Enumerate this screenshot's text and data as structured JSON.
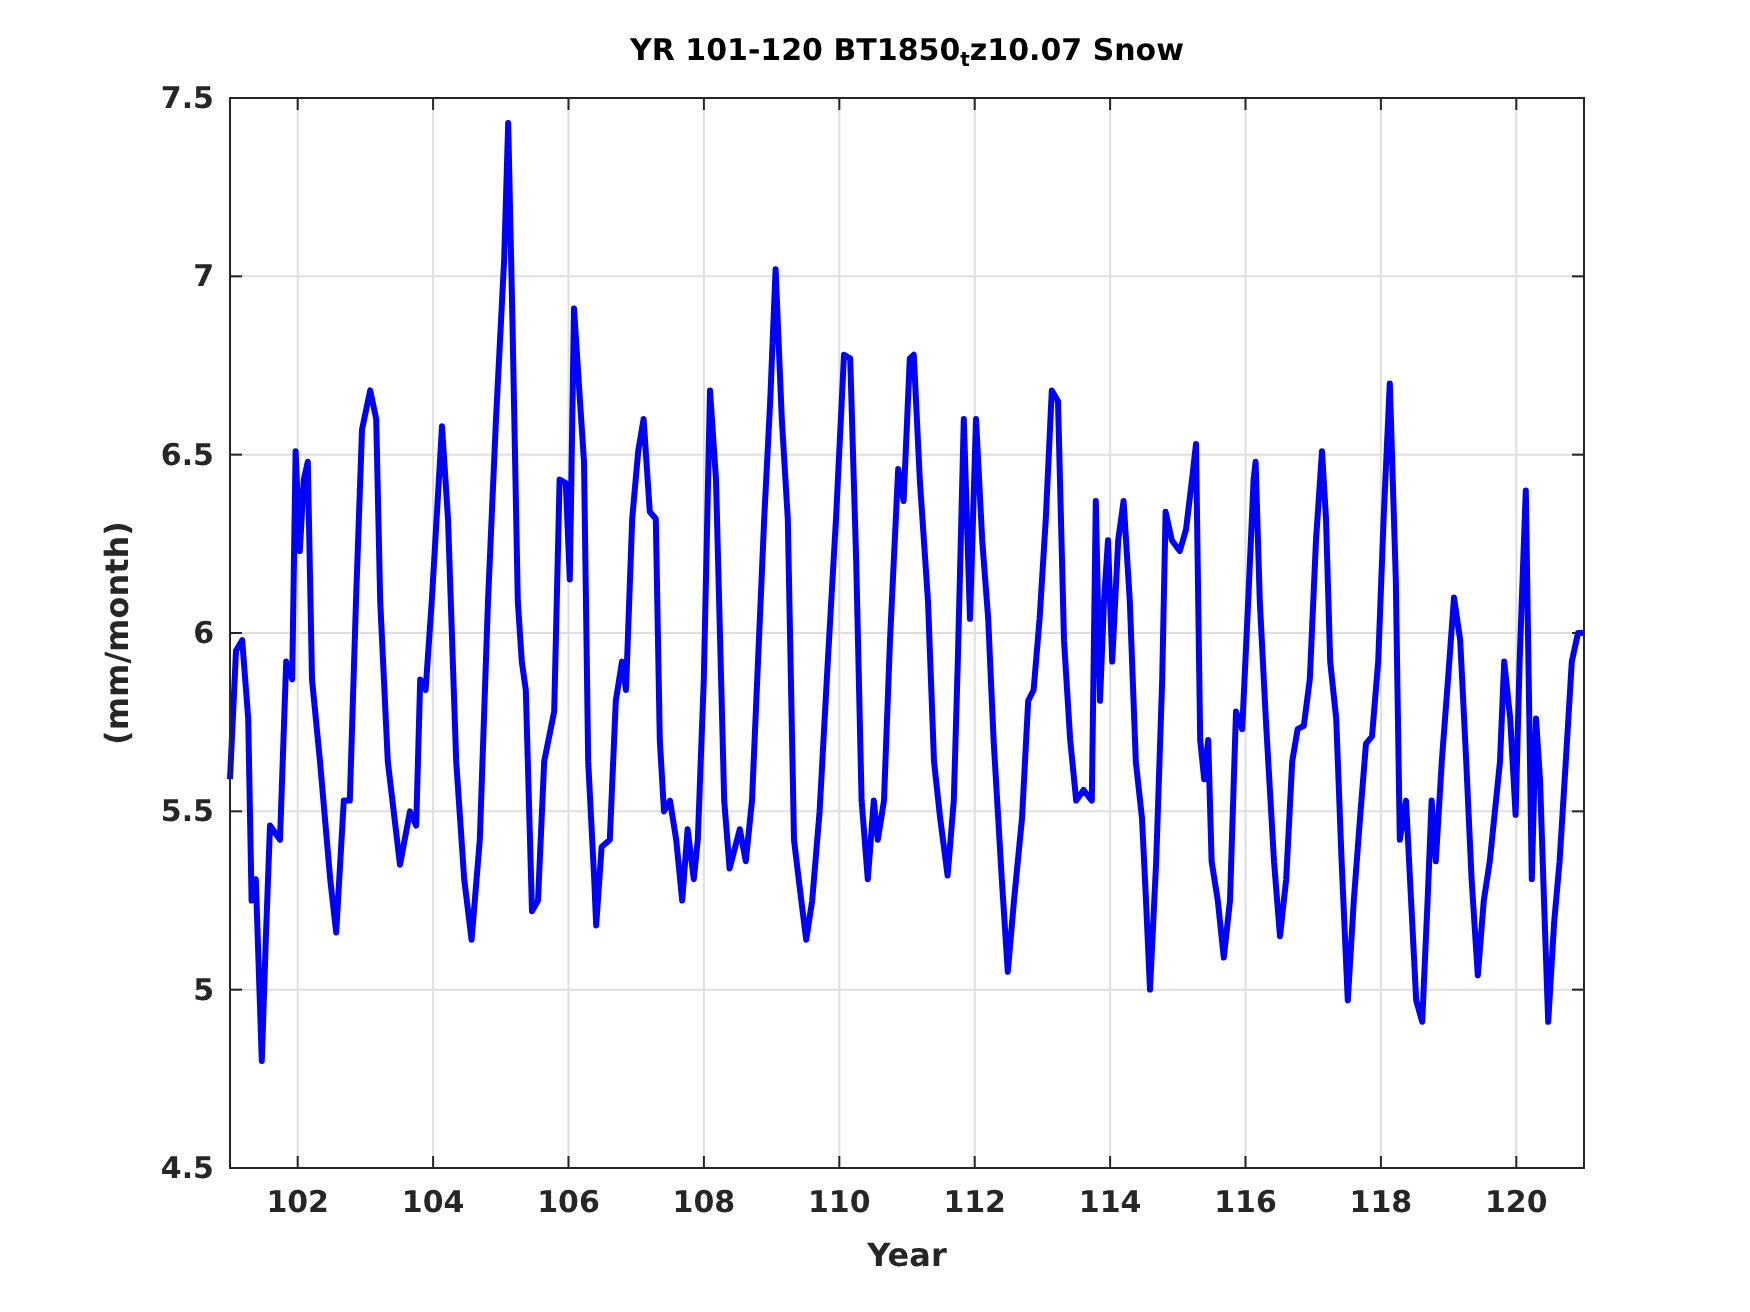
{
  "figure": {
    "chart_data": {
      "type": "line",
      "grid": true,
      "title": "YR 101-120 BT1850$_{t}$z10.07 Snow",
      "xlabel": "Year",
      "ylabel": "(mm/month)",
      "xlim": [
        101,
        121
      ],
      "ylim": [
        4.5,
        7.5
      ],
      "xticks": [
        102,
        104,
        106,
        108,
        110,
        112,
        114,
        116,
        118,
        120
      ],
      "yticks": [
        4.5,
        {
          "value": 5,
          "label": "5"
        },
        5.5,
        {
          "value": 6,
          "label": "6"
        },
        6.5,
        {
          "value": 7,
          "label": "7"
        },
        7.5
      ],
      "x": [
        101.0,
        101.09,
        101.18,
        101.27,
        101.32,
        101.38,
        101.44,
        101.47,
        101.53,
        101.59,
        101.74,
        101.83,
        101.92,
        101.97,
        102.03,
        102.09,
        102.15,
        102.21,
        102.33,
        102.48,
        102.57,
        102.68,
        102.77,
        102.86,
        102.95,
        103.07,
        103.16,
        103.22,
        103.33,
        103.51,
        103.66,
        103.75,
        103.81,
        103.89,
        103.98,
        104.13,
        104.22,
        104.34,
        104.46,
        104.57,
        104.69,
        104.81,
        104.93,
        105.05,
        105.11,
        105.17,
        105.25,
        105.31,
        105.37,
        105.46,
        105.55,
        105.64,
        105.79,
        105.87,
        105.96,
        106.02,
        106.08,
        106.17,
        106.23,
        106.29,
        106.38,
        106.41,
        106.49,
        106.61,
        106.7,
        106.79,
        106.85,
        106.94,
        107.03,
        107.11,
        107.2,
        107.29,
        107.35,
        107.41,
        107.5,
        107.59,
        107.68,
        107.76,
        107.85,
        107.91,
        108.0,
        108.09,
        108.18,
        108.3,
        108.38,
        108.53,
        108.62,
        108.71,
        108.8,
        108.89,
        108.98,
        109.06,
        109.15,
        109.24,
        109.33,
        109.42,
        109.51,
        109.6,
        109.71,
        109.83,
        109.95,
        110.07,
        110.16,
        110.25,
        110.33,
        110.42,
        110.51,
        110.57,
        110.66,
        110.75,
        110.87,
        110.95,
        111.04,
        111.1,
        111.19,
        111.31,
        111.4,
        111.49,
        111.6,
        111.69,
        111.75,
        111.84,
        111.93,
        112.02,
        112.11,
        112.2,
        112.28,
        112.4,
        112.49,
        112.58,
        112.7,
        112.79,
        112.87,
        112.96,
        113.05,
        113.14,
        113.23,
        113.32,
        113.41,
        113.5,
        113.61,
        113.73,
        113.79,
        113.85,
        113.91,
        113.97,
        114.03,
        114.12,
        114.2,
        114.29,
        114.38,
        114.47,
        114.53,
        114.59,
        114.68,
        114.77,
        114.82,
        114.91,
        115.03,
        115.12,
        115.21,
        115.27,
        115.33,
        115.39,
        115.45,
        115.5,
        115.59,
        115.68,
        115.77,
        115.86,
        115.95,
        116.04,
        116.12,
        116.15,
        116.21,
        116.3,
        116.42,
        116.51,
        116.6,
        116.69,
        116.77,
        116.86,
        116.95,
        117.04,
        117.13,
        117.19,
        117.25,
        117.34,
        117.42,
        117.51,
        117.6,
        117.69,
        117.78,
        117.87,
        117.96,
        118.04,
        118.13,
        118.22,
        118.28,
        118.37,
        118.43,
        118.52,
        118.61,
        118.69,
        118.75,
        118.81,
        118.9,
        118.99,
        119.08,
        119.17,
        119.26,
        119.34,
        119.43,
        119.52,
        119.61,
        119.7,
        119.76,
        119.82,
        119.91,
        119.99,
        120.05,
        120.14,
        120.23,
        120.29,
        120.35,
        120.41,
        120.47,
        120.56,
        120.64,
        120.73,
        120.82,
        120.91,
        121.0
      ],
      "series": [
        {
          "color": "#0000ff",
          "values": [
            5.59,
            5.95,
            5.98,
            5.76,
            5.25,
            5.31,
            4.97,
            4.8,
            5.14,
            5.46,
            5.42,
            5.92,
            5.87,
            6.51,
            6.23,
            6.43,
            6.48,
            5.87,
            5.64,
            5.31,
            5.16,
            5.53,
            5.53,
            6.09,
            6.57,
            6.68,
            6.6,
            6.09,
            5.64,
            5.35,
            5.5,
            5.46,
            5.87,
            5.84,
            6.09,
            6.58,
            6.32,
            5.64,
            5.31,
            5.14,
            5.42,
            6.09,
            6.6,
            7.05,
            7.43,
            6.88,
            6.09,
            5.92,
            5.84,
            5.22,
            5.25,
            5.64,
            5.78,
            6.43,
            6.42,
            6.15,
            6.91,
            6.65,
            6.48,
            5.64,
            5.31,
            5.18,
            5.4,
            5.42,
            5.81,
            5.92,
            5.84,
            6.32,
            6.51,
            6.6,
            6.34,
            6.32,
            5.7,
            5.5,
            5.53,
            5.42,
            5.25,
            5.45,
            5.31,
            5.42,
            5.87,
            6.68,
            6.43,
            5.53,
            5.34,
            5.45,
            5.36,
            5.53,
            5.92,
            6.32,
            6.65,
            7.02,
            6.6,
            6.32,
            5.42,
            5.28,
            5.14,
            5.25,
            5.5,
            5.92,
            6.32,
            6.78,
            6.77,
            6.2,
            5.53,
            5.31,
            5.53,
            5.42,
            5.53,
            5.98,
            6.46,
            6.37,
            6.77,
            6.78,
            6.43,
            6.09,
            5.64,
            5.48,
            5.32,
            5.53,
            5.92,
            6.6,
            6.04,
            6.6,
            6.26,
            6.04,
            5.7,
            5.31,
            5.05,
            5.25,
            5.48,
            5.81,
            5.84,
            6.04,
            6.32,
            6.68,
            6.65,
            5.98,
            5.7,
            5.53,
            5.56,
            5.53,
            6.37,
            5.81,
            6.09,
            6.26,
            5.92,
            6.26,
            6.37,
            6.09,
            5.64,
            5.48,
            5.25,
            5.0,
            5.36,
            5.87,
            6.34,
            6.26,
            6.23,
            6.29,
            6.43,
            6.53,
            5.7,
            5.59,
            5.7,
            5.36,
            5.25,
            5.09,
            5.25,
            5.78,
            5.73,
            6.09,
            6.43,
            6.48,
            6.09,
            5.76,
            5.36,
            5.15,
            5.31,
            5.64,
            5.73,
            5.74,
            5.87,
            6.26,
            6.51,
            6.32,
            5.92,
            5.76,
            5.36,
            4.97,
            5.25,
            5.48,
            5.69,
            5.71,
            5.92,
            6.32,
            6.7,
            6.15,
            5.42,
            5.53,
            5.31,
            4.97,
            4.91,
            5.25,
            5.53,
            5.36,
            5.64,
            5.87,
            6.1,
            5.98,
            5.64,
            5.31,
            5.04,
            5.25,
            5.36,
            5.53,
            5.64,
            5.92,
            5.76,
            5.49,
            5.92,
            6.4,
            5.31,
            5.76,
            5.59,
            5.25,
            4.91,
            5.19,
            5.36,
            5.64,
            5.92,
            6.0,
            6.0
          ]
        }
      ]
    }
  }
}
